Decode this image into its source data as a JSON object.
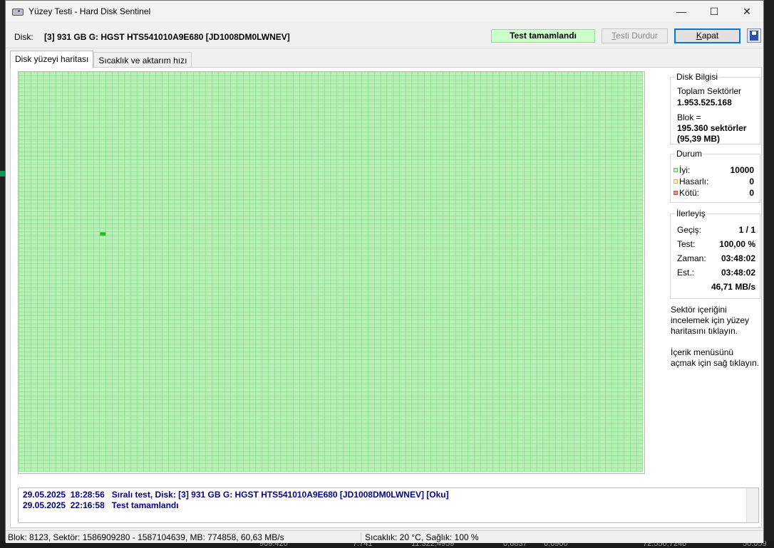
{
  "window": {
    "title": "Yüzey Testi - Hard Disk Sentinel",
    "controls": {
      "minimize": "—",
      "maximize": "☐",
      "close": "✕"
    }
  },
  "header": {
    "disk_label": "Disk:",
    "disk_name": "[3] 931 GB G: HGST HTS541010A9E680 [JD1008DM0LWNEV]",
    "status": "Test tamamlandı",
    "stop_button_prefix": "T",
    "stop_button_rest": "esti Durdur",
    "close_button_prefix": "K",
    "close_button_rest": "apat",
    "save_icon": "floppy-disk-icon"
  },
  "tabs": [
    {
      "label": "Disk yüzeyi haritası",
      "active": true
    },
    {
      "label": "Sıcaklık ve aktarım hızı",
      "active": false
    }
  ],
  "surface_map": {
    "block_count": 10000,
    "columns": 100,
    "rows": 100,
    "good_color": "#b8f0b8",
    "grid_color": "#7fd77f",
    "current_block_color": "#22bb22",
    "current_block_index": 4013
  },
  "disk_info": {
    "title": "Disk Bilgisi",
    "total_sectors_label": "Toplam Sektörler",
    "total_sectors_value": "1.953.525.168",
    "block_label": "Blok =",
    "block_sectors": "195.360 sektörler",
    "block_size": "(95,39 MB)"
  },
  "status_group": {
    "title": "Durum",
    "items": [
      {
        "label": "İyi:",
        "value": "10000",
        "color": "#9fe09f"
      },
      {
        "label": "Hasarlı:",
        "value": "0",
        "color": "#f5e6a0"
      },
      {
        "label": "Kötü:",
        "value": "0",
        "color": "#f08c8c"
      }
    ]
  },
  "progress": {
    "title": "İlerleyiş",
    "pass_label": "Geçiş:",
    "pass_value": "1 / 1",
    "test_label": "Test:",
    "test_value": "100,00 %",
    "time_label": "Zaman:",
    "time_value": "03:48:02",
    "est_label": "Est.:",
    "est_value": "03:48:02",
    "speed": "46,71 MB/s"
  },
  "hints": {
    "line1": "Sektör içeriğini",
    "line2": "incelemek için yüzey",
    "line3": "haritasını tıklayın.",
    "line4": "İçerik menüsünü",
    "line5": "açmak için sağ tıklayın."
  },
  "log": [
    {
      "date": "29.05.2025",
      "time": "18:28:56",
      "message": "Sıralı test, Disk: [3] 931 GB G: HGST HTS541010A9E680 [JD1008DM0LWNEV] [Oku]"
    },
    {
      "date": "29.05.2025",
      "time": "22:16:58",
      "message": "Test tamamlandı"
    }
  ],
  "statusbar": {
    "left": "Blok: 8123, Sektör: 1586909280 - 1587104639, MB: 774858, 60,63 MB/s",
    "right": "Sıcaklık: 20  °C,  Sağlık: 100 %"
  },
  "background": {
    "bottom_numbers": [
      "909.420",
      "7.741",
      "11.322,4959",
      "0,6837",
      "0,6900",
      "72.550,7246",
      "50.059"
    ]
  }
}
